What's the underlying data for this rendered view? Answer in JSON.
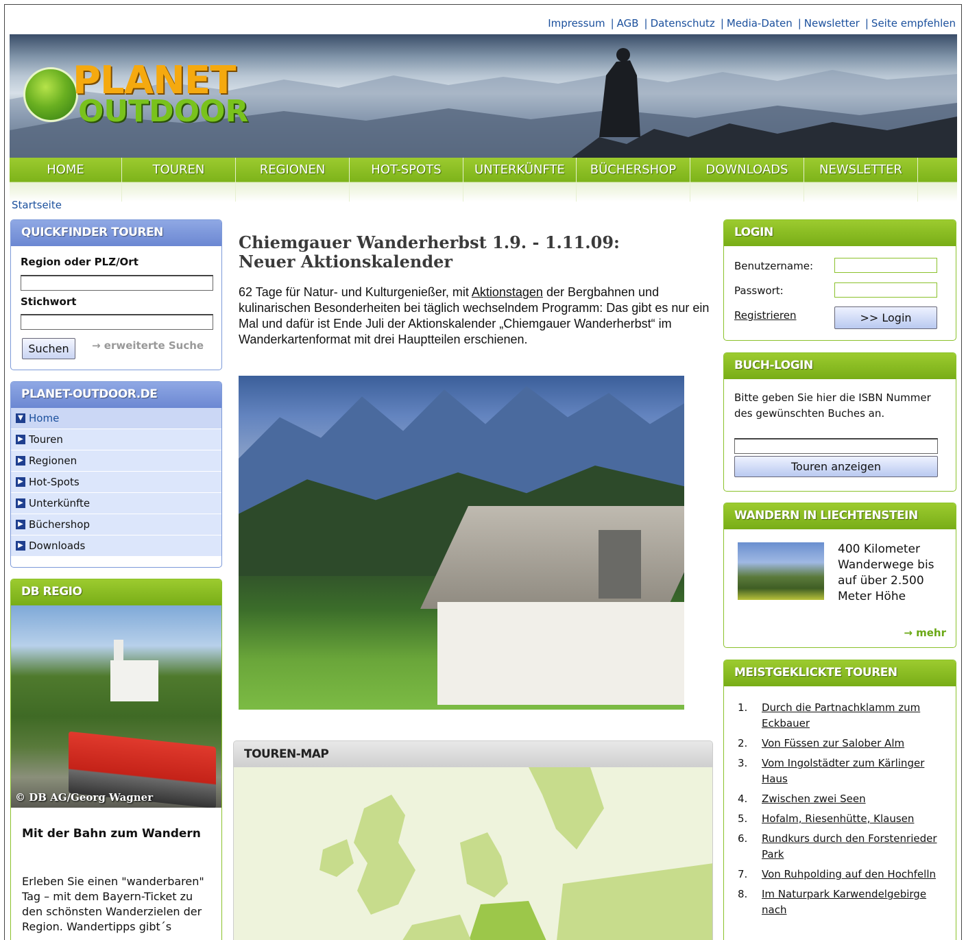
{
  "top_links": [
    "Impressum",
    "AGB",
    "Datenschutz",
    "Media-Daten",
    "Newsletter",
    "Seite empfehlen"
  ],
  "logo": {
    "line1": "PLANET",
    "line2": "OUTDOOR"
  },
  "nav": [
    "HOME",
    "TOUREN",
    "REGIONEN",
    "HOT-SPOTS",
    "UNTERKÜNFTE",
    "BÜCHERSHOP",
    "DOWNLOADS",
    "NEWSLETTER"
  ],
  "breadcrumb": "Startseite",
  "quickfinder": {
    "title": "QUICKFINDER TOUREN",
    "region_label": "Region oder PLZ/Ort",
    "keyword_label": "Stichwort",
    "search_button": "Suchen",
    "extended_search": "erweiterte Suche"
  },
  "site_menu": {
    "title": "PLANET-OUTDOOR.DE",
    "items": [
      "Home",
      "Touren",
      "Regionen",
      "Hot-Spots",
      "Unterkünfte",
      "Büchershop",
      "Downloads"
    ]
  },
  "db_regio": {
    "title": "DB REGIO",
    "photo_credit": "© DB AG/Georg Wagner",
    "headline": "Mit der Bahn zum Wandern",
    "text": "Erleben Sie einen \"wanderbaren\" Tag – mit dem Bayern-Ticket zu den schönsten Wanderzielen der Region. Wandertipps gibt´s"
  },
  "article": {
    "headline": "Chiemgauer Wanderherbst 1.9. - 1.11.09: Neuer Aktionskalender",
    "lead_before": "62 Tage für Natur- und Kulturgenießer, mit ",
    "lead_link": "Aktionstagen",
    "lead_after": " der Bergbahnen und kulinarischen Besonderheiten bei täglich wechselndem Programm: Das gibt es nur ein Mal und dafür ist Ende Juli der Aktionskalender „Chiemgauer Wanderherbst“ im Wanderkartenformat mit drei Hauptteilen erschienen."
  },
  "touren_map": {
    "title": "TOUREN-MAP"
  },
  "login": {
    "title": "LOGIN",
    "username_label": "Benutzername:",
    "password_label": "Passwort:",
    "register": "Registrieren",
    "login_button": ">> Login"
  },
  "buch_login": {
    "title": "BUCH-LOGIN",
    "text": "Bitte geben Sie hier die ISBN Nummer des gewünschten Buches an.",
    "button": "Touren anzeigen"
  },
  "liechtenstein": {
    "title": "WANDERN IN LIECHTENSTEIN",
    "text": "400 Kilometer Wanderwege bis auf über 2.500 Meter Höhe",
    "more": "mehr"
  },
  "meistgeklickte": {
    "title": "MEISTGEKLICKTE TOUREN",
    "items": [
      "Durch die Partnachklamm zum Eckbauer",
      "Von Füssen zur Salober Alm",
      "Vom Ingolstädter zum Kärlinger Haus",
      "Zwischen zwei Seen",
      "Hofalm, Riesenhütte, Klausen",
      "Rundkurs durch den Forstenrieder Park",
      "Von Ruhpolding auf den Hochfelln",
      "Im Naturpark Karwendelgebirge nach"
    ]
  },
  "colors": {
    "green": "#8ac12a",
    "blue": "#7c99d8",
    "link": "#1a4f9c"
  }
}
